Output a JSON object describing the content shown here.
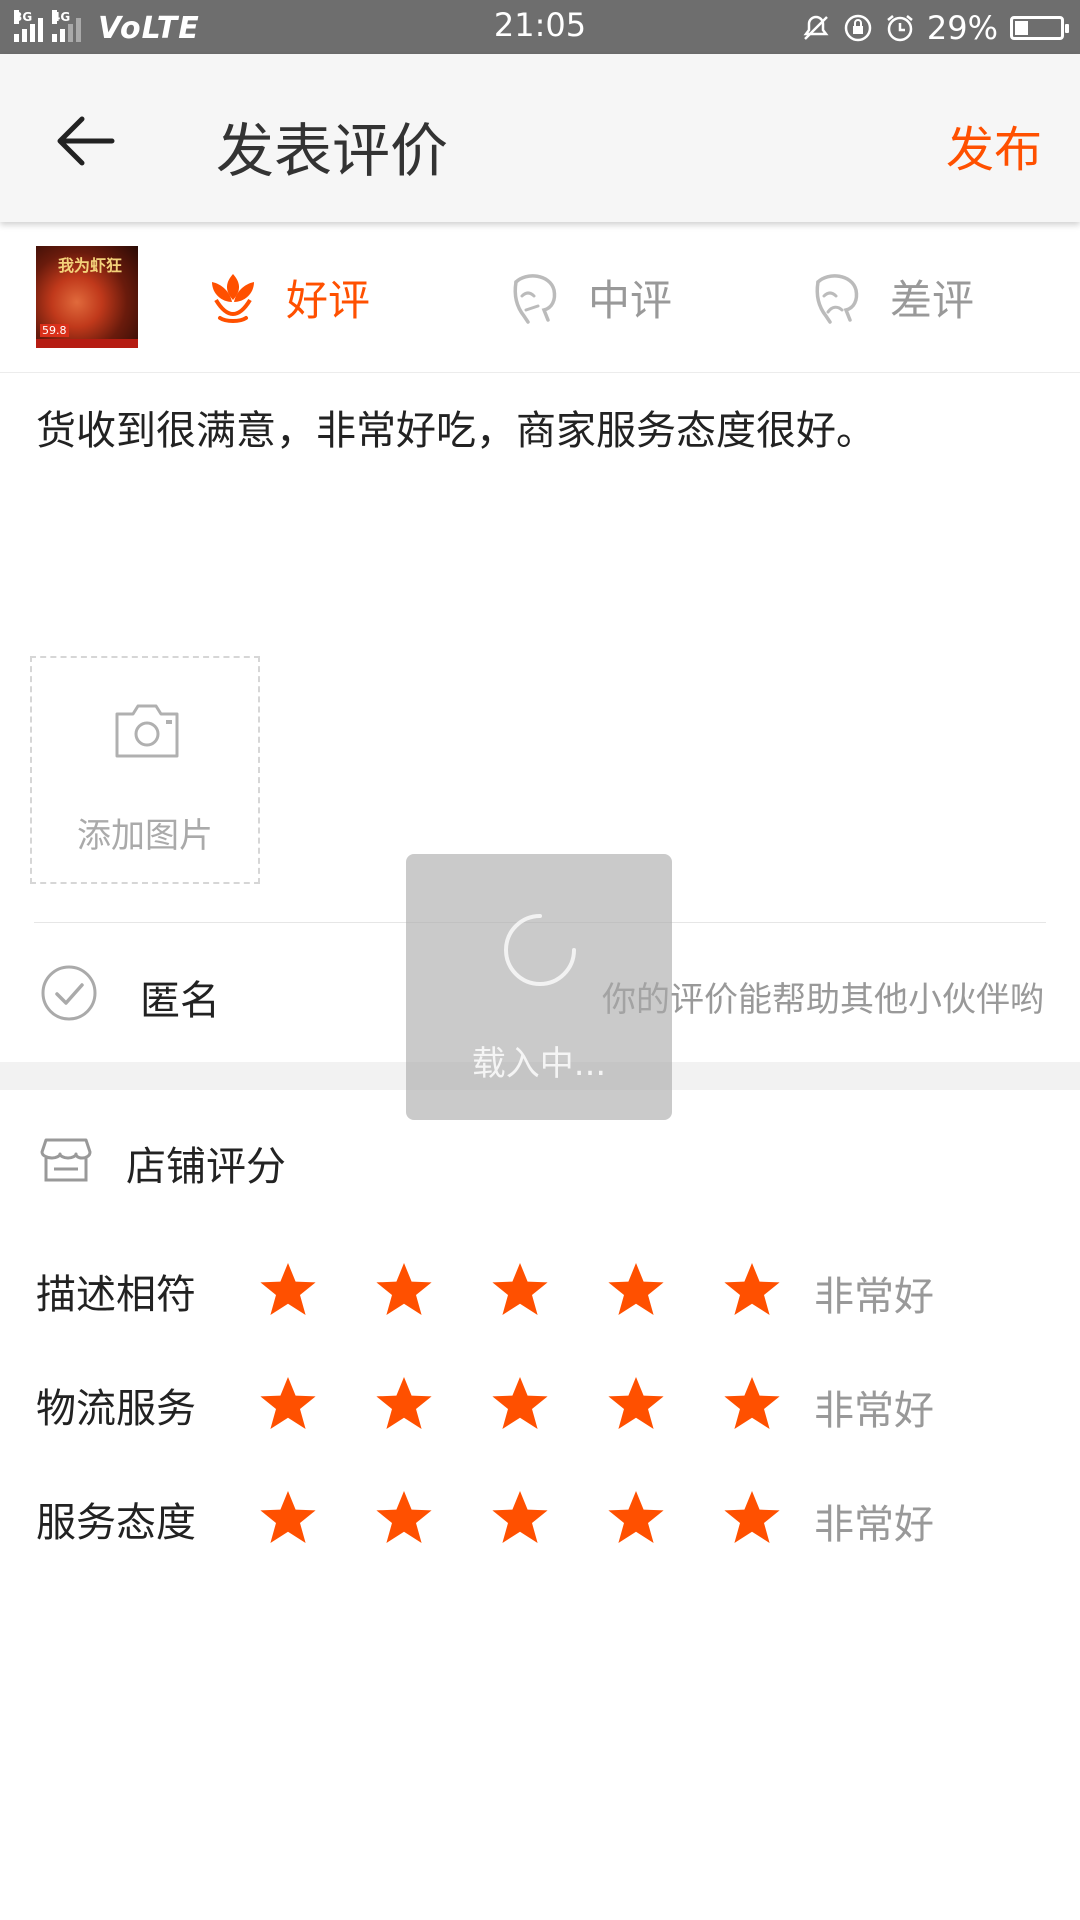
{
  "status_bar": {
    "network_left": "3G",
    "network_right": "4G",
    "volte": "VoLTE",
    "time": "21:05",
    "battery_percent": "29%",
    "battery_level": 0.29,
    "icons": [
      "mute-icon",
      "rotation-lock-icon",
      "alarm-icon",
      "battery-icon"
    ]
  },
  "header": {
    "back_icon": "arrow-left-icon",
    "title": "发表评价",
    "publish_label": "发布"
  },
  "rating": {
    "options": [
      {
        "label": "好评",
        "icon": "flower-icon",
        "selected": true
      },
      {
        "label": "中评",
        "icon": "face-neutral-icon",
        "selected": false
      },
      {
        "label": "差评",
        "icon": "face-sad-icon",
        "selected": false
      }
    ]
  },
  "product_thumb": {
    "title_text": "我为虾狂",
    "price_text": "59.8"
  },
  "comment": {
    "text": "货收到很满意，非常好吃，商家服务态度很好。"
  },
  "add_photo": {
    "label": "添加图片"
  },
  "anonymous": {
    "label": "匿名",
    "checked": false,
    "hint": "你的评价能帮助其他小伙伴哟"
  },
  "shop_score": {
    "title": "店铺评分",
    "rows": [
      {
        "label": "描述相符",
        "stars": 5,
        "max": 5,
        "text": "非常好"
      },
      {
        "label": "物流服务",
        "stars": 5,
        "max": 5,
        "text": "非常好"
      },
      {
        "label": "服务态度",
        "stars": 5,
        "max": 5,
        "text": "非常好"
      }
    ]
  },
  "loading": {
    "text": "载入中..."
  },
  "colors": {
    "accent": "#ff5000",
    "muted": "#999999",
    "status_bar": "#6e6e6e"
  }
}
